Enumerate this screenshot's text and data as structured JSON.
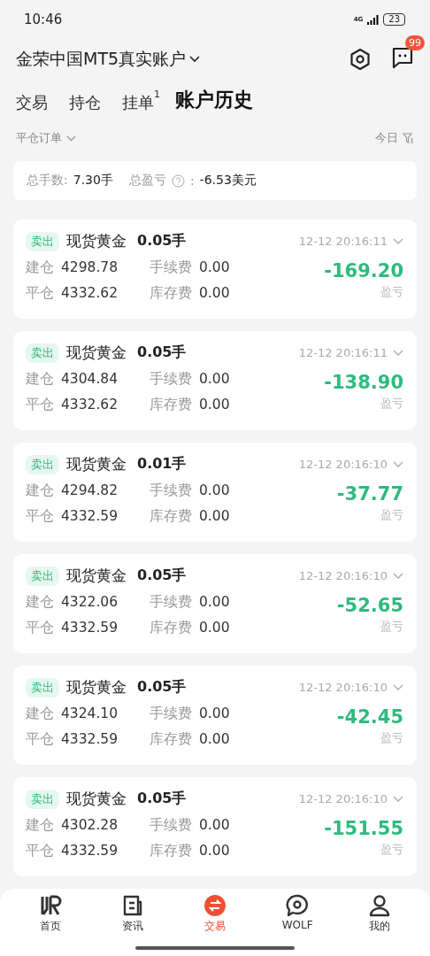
{
  "status_bar": {
    "time": "10:46",
    "network": "4G",
    "battery": "23"
  },
  "header": {
    "account": "金荣中国MT5真实账户",
    "message_badge": "99"
  },
  "tabs": [
    {
      "label": "交易",
      "selected": false
    },
    {
      "label": "持仓",
      "selected": false
    },
    {
      "label": "挂单",
      "badge": "1",
      "selected": false
    },
    {
      "label": "账户历史",
      "selected": true
    }
  ],
  "filter": {
    "type": "平仓订单",
    "period": "今日"
  },
  "summary": {
    "lots_label": "总手数:",
    "lots": "7.30手",
    "pnl_label": "总盈亏",
    "pnl_sep": ":",
    "pnl": "-6.53美元"
  },
  "orders": [
    {
      "side": "卖出",
      "symbol": "现货黄金",
      "lots": "0.05手",
      "time": "12-12 20:16:11",
      "open_label": "建仓",
      "open": "4298.78",
      "close_label": "平仓",
      "close": "4332.62",
      "fee_label": "手续费",
      "fee": "0.00",
      "swap_label": "库存费",
      "swap": "0.00",
      "pnl": "-169.20",
      "pnl_label": "盈亏"
    },
    {
      "side": "卖出",
      "symbol": "现货黄金",
      "lots": "0.05手",
      "time": "12-12 20:16:11",
      "open_label": "建仓",
      "open": "4304.84",
      "close_label": "平仓",
      "close": "4332.62",
      "fee_label": "手续费",
      "fee": "0.00",
      "swap_label": "库存费",
      "swap": "0.00",
      "pnl": "-138.90",
      "pnl_label": "盈亏"
    },
    {
      "side": "卖出",
      "symbol": "现货黄金",
      "lots": "0.01手",
      "time": "12-12 20:16:10",
      "open_label": "建仓",
      "open": "4294.82",
      "close_label": "平仓",
      "close": "4332.59",
      "fee_label": "手续费",
      "fee": "0.00",
      "swap_label": "库存费",
      "swap": "0.00",
      "pnl": "-37.77",
      "pnl_label": "盈亏"
    },
    {
      "side": "卖出",
      "symbol": "现货黄金",
      "lots": "0.05手",
      "time": "12-12 20:16:10",
      "open_label": "建仓",
      "open": "4322.06",
      "close_label": "平仓",
      "close": "4332.59",
      "fee_label": "手续费",
      "fee": "0.00",
      "swap_label": "库存费",
      "swap": "0.00",
      "pnl": "-52.65",
      "pnl_label": "盈亏"
    },
    {
      "side": "卖出",
      "symbol": "现货黄金",
      "lots": "0.05手",
      "time": "12-12 20:16:10",
      "open_label": "建仓",
      "open": "4324.10",
      "close_label": "平仓",
      "close": "4332.59",
      "fee_label": "手续费",
      "fee": "0.00",
      "swap_label": "库存费",
      "swap": "0.00",
      "pnl": "-42.45",
      "pnl_label": "盈亏"
    },
    {
      "side": "卖出",
      "symbol": "现货黄金",
      "lots": "0.05手",
      "time": "12-12 20:16:10",
      "open_label": "建仓",
      "open": "4302.28",
      "close_label": "平仓",
      "close": "4332.59",
      "fee_label": "手续费",
      "fee": "0.00",
      "swap_label": "库存费",
      "swap": "0.00",
      "pnl": "-151.55",
      "pnl_label": "盈亏"
    }
  ],
  "bottom_nav": [
    {
      "kind": "home",
      "label": "首页",
      "selected": false
    },
    {
      "kind": "news",
      "label": "资讯",
      "selected": false
    },
    {
      "kind": "trade",
      "label": "交易",
      "selected": true
    },
    {
      "kind": "chat",
      "label": "WOLF",
      "selected": false
    },
    {
      "kind": "user",
      "label": "我的",
      "selected": false
    }
  ]
}
